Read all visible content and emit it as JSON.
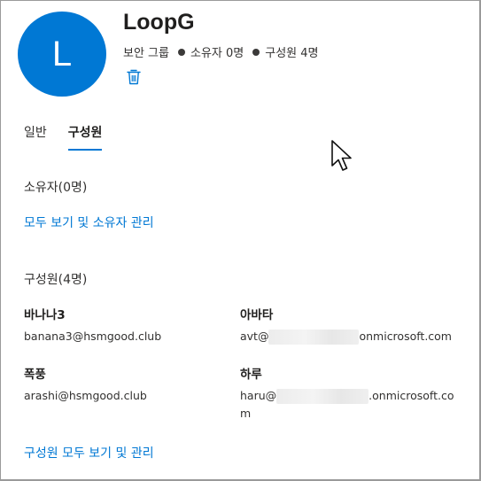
{
  "group": {
    "avatar_letter": "L",
    "name": "LoopG",
    "type": "보안 그룹",
    "owner_count_text": "소유자 0명",
    "member_count_text": "구성원 4명"
  },
  "tabs": [
    {
      "label": "일반",
      "active": false
    },
    {
      "label": "구성원",
      "active": true
    }
  ],
  "owners": {
    "heading": "소유자(0명)",
    "manage_link": "모두 보기 및 소유자 관리"
  },
  "members": {
    "heading": "구성원(4명)",
    "list": [
      {
        "name": "바나나3",
        "email": "banana3@hsmgood.club"
      },
      {
        "name": "아바타",
        "email_prefix": "avt@",
        "email_suffix": "onmicrosoft.com"
      },
      {
        "name": "폭풍",
        "email": "arashi@hsmgood.club"
      },
      {
        "name": "하루",
        "email_prefix": "haru@",
        "email_suffix": ".onmicrosoft.co",
        "email_wrap": "m"
      }
    ],
    "manage_link": "구성원 모두 보기 및 관리"
  },
  "colors": {
    "accent": "#0078d4",
    "text": "#323130"
  },
  "icons": {
    "delete": "trash-icon",
    "pointer": "mouse-cursor-icon"
  }
}
